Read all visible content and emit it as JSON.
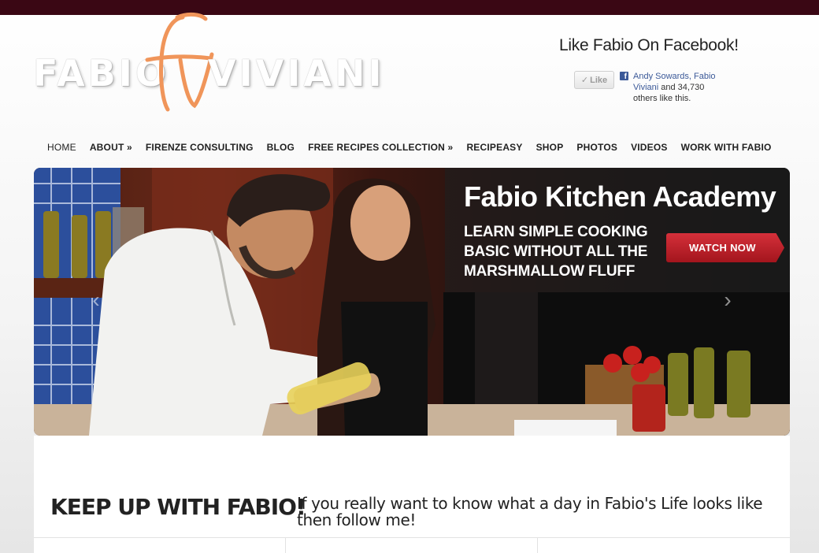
{
  "logo": {
    "first": "FABIO",
    "monogram": "FV",
    "last": "VIVIANI"
  },
  "facebook": {
    "title": "Like Fabio On Facebook!",
    "like_label": "Like",
    "friends": "Andy Sowards, Fabio Viviani",
    "others": " and 34,730 others like this."
  },
  "nav": {
    "items": [
      {
        "label": "HOME"
      },
      {
        "label": "ABOUT »"
      },
      {
        "label": "FIRENZE CONSULTING"
      },
      {
        "label": "BLOG"
      },
      {
        "label": "FREE RECIPES COLLECTION »"
      },
      {
        "label": "RECIPEASY"
      },
      {
        "label": "SHOP"
      },
      {
        "label": "PHOTOS"
      },
      {
        "label": "VIDEOS"
      },
      {
        "label": "WORK WITH FABIO"
      }
    ]
  },
  "slider": {
    "title": "Fabio Kitchen Academy",
    "subtitle": "LEARN SIMPLE COOKING BASIC WITHOUT ALL THE MARSHMALLOW FLUFF",
    "cta": "WATCH NOW",
    "prev_glyph": "‹",
    "next_glyph": "›"
  },
  "section": {
    "title": "KEEP UP WITH FABIO!",
    "text": "If you really want to know what a day in Fabio's Life looks like then follow me!"
  },
  "colors": {
    "top_bar": "#3a0714",
    "logo_accent": "#f0955a",
    "cta_red": "#c1242d",
    "facebook_blue": "#3b5998"
  }
}
